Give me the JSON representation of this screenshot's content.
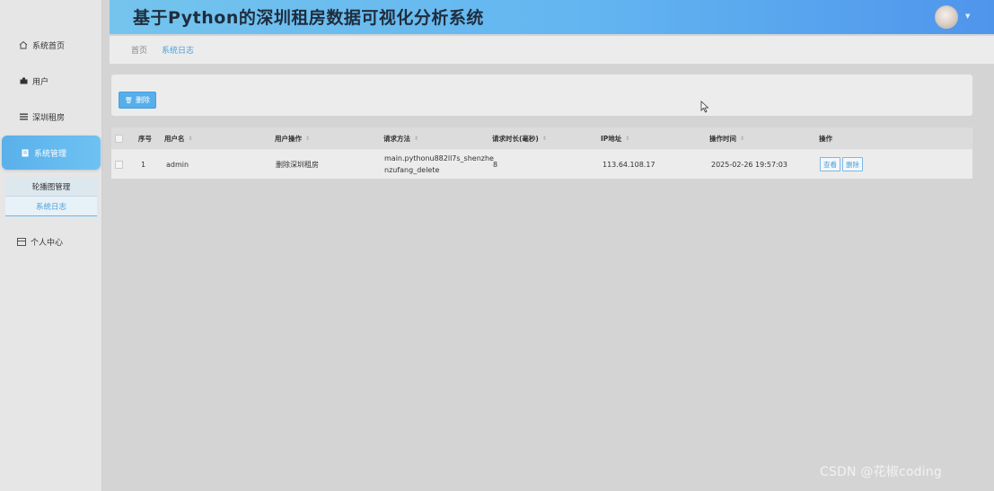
{
  "header": {
    "title": "基于Python的深圳租房数据可视化分析系统"
  },
  "sidebar": {
    "items": [
      {
        "label": "系统首页",
        "icon": "home-icon"
      },
      {
        "label": "用户",
        "icon": "user-icon"
      },
      {
        "label": "深圳租房",
        "icon": "list-icon"
      },
      {
        "label": "系统管理",
        "icon": "doc-icon"
      },
      {
        "label": "个人中心",
        "icon": "card-icon"
      }
    ],
    "submenu": [
      {
        "label": "轮播图管理"
      },
      {
        "label": "系统日志"
      }
    ]
  },
  "breadcrumb": {
    "home": "首页",
    "current": "系统日志"
  },
  "toolbar": {
    "delete_label": "删除"
  },
  "table": {
    "headers": {
      "index": "序号",
      "username": "用户名",
      "operation": "用户操作",
      "method": "请求方法",
      "duration": "请求时长(毫秒)",
      "ip": "IP地址",
      "time": "操作时间",
      "actions": "操作"
    },
    "rows": [
      {
        "index": "1",
        "username": "admin",
        "operation": "删除深圳租房",
        "method": "main.pythonu882ll7s_shenzhenzufang_delete",
        "duration": "8",
        "ip": "113.64.108.17",
        "time": "2025-02-26 19:57:03",
        "view_label": "查看",
        "delete_label": "删除"
      }
    ]
  },
  "watermark": "CSDN @花椒coding",
  "colors": {
    "accent": "#56aeea",
    "header_start": "#74c4ee",
    "header_end": "#4f95ec"
  }
}
